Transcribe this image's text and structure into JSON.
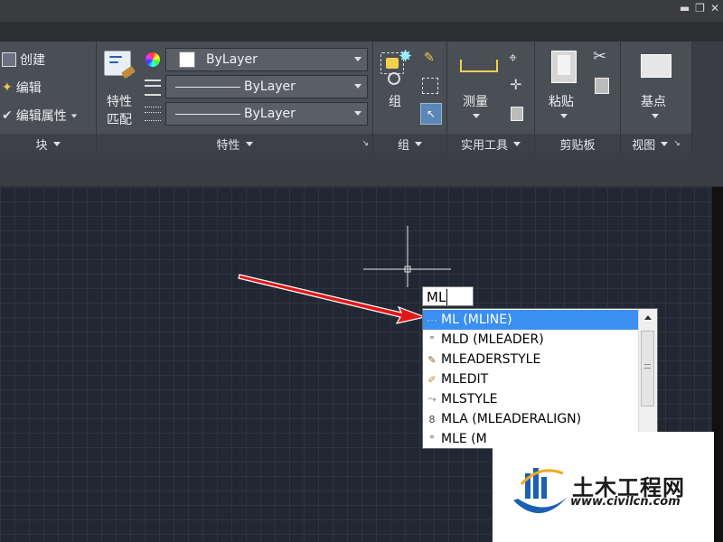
{
  "window": {
    "min": "▬",
    "restore": "❐",
    "close": "✕"
  },
  "ribbon": {
    "block_panel": {
      "items": [
        "创建",
        "编辑",
        "编辑属性"
      ],
      "title": "块"
    },
    "properties_panel": {
      "match_label_1": "特性",
      "match_label_2": "匹配",
      "color_value": "ByLayer",
      "linetype_value": "ByLayer",
      "lineweight_value": "ByLayer",
      "title": "特性"
    },
    "group_panel": {
      "label": "组",
      "title": "组"
    },
    "utilities_panel": {
      "measure_label": "测量",
      "title": "实用工具"
    },
    "clipboard_panel": {
      "paste_label": "粘贴",
      "title": "剪贴板"
    },
    "view_panel": {
      "basepoint_label": "基点",
      "title": "视图"
    }
  },
  "command": {
    "input_value": "ML",
    "suggestions": [
      {
        "label": "ML (MLINE)",
        "icon": "mline-icon",
        "selected": true
      },
      {
        "label": "MLD (MLEADER)",
        "icon": "mleader-icon",
        "selected": false
      },
      {
        "label": "MLEADERSTYLE",
        "icon": "mleaderstyle-icon",
        "selected": false
      },
      {
        "label": "MLEDIT",
        "icon": "mledit-icon",
        "selected": false
      },
      {
        "label": "MLSTYLE",
        "icon": "mlstyle-icon",
        "selected": false
      },
      {
        "label": "MLA (MLEADERALIGN)",
        "icon": "mleaderalign-icon",
        "selected": false
      },
      {
        "label": "MLE (M",
        "icon": "mle-icon",
        "selected": false
      }
    ]
  },
  "watermark": {
    "title": "土木工程网",
    "url": "www.civilcn.com"
  },
  "colors": {
    "accent": "#3b8ff0",
    "arrow": "#e01818"
  }
}
